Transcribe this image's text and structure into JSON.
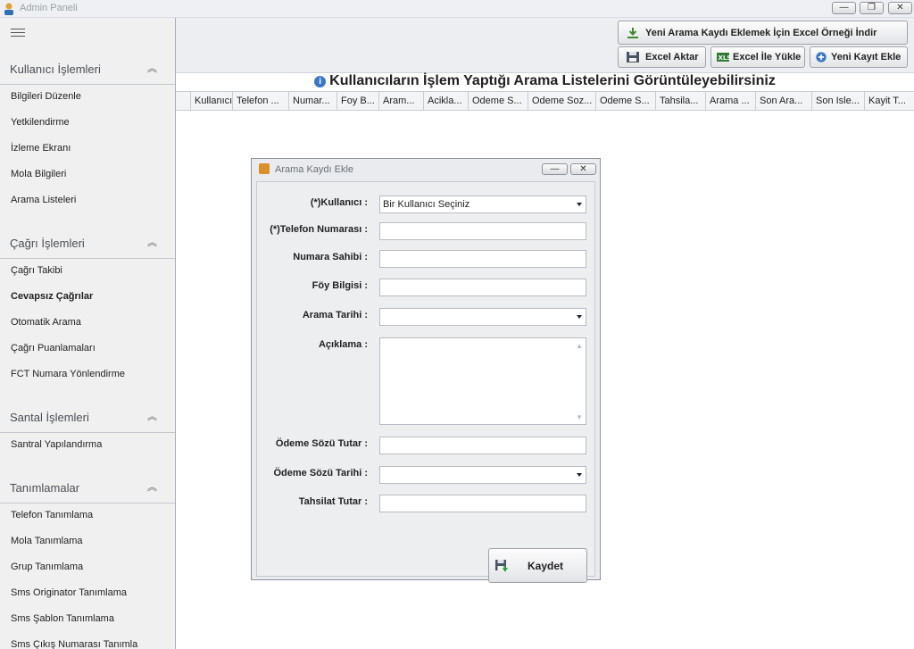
{
  "window": {
    "title": "Admin Paneli",
    "buttons": [
      "—",
      "❐",
      "✕"
    ]
  },
  "sidebar": {
    "groups": [
      {
        "title": "Kullanıcı İşlemleri",
        "items": [
          {
            "label": "Bilgileri Düzenle"
          },
          {
            "label": "Yetkilendirme"
          },
          {
            "label": "İzleme Ekranı"
          },
          {
            "label": "Mola Bilgileri"
          },
          {
            "label": "Arama Listeleri"
          }
        ]
      },
      {
        "title": "Çağrı İşlemleri",
        "items": [
          {
            "label": "Çağrı Takibi"
          },
          {
            "label": "Cevapsız Çağrılar"
          },
          {
            "label": "Otomatik Arama"
          },
          {
            "label": "Çağrı Puanlamaları"
          },
          {
            "label": "FCT Numara Yönlendirme"
          }
        ]
      },
      {
        "title": "Santal İşlemleri",
        "items": [
          {
            "label": "Santral Yapılandırma"
          }
        ]
      },
      {
        "title": "Tanımlamalar",
        "items": [
          {
            "label": "Telefon Tanımlama"
          },
          {
            "label": "Mola Tanımlama"
          },
          {
            "label": "Grup Tanımlama"
          },
          {
            "label": "Sms Originator Tanımlama"
          },
          {
            "label": "Sms Şablon Tanımlama"
          },
          {
            "label": "Sms Çıkış Numarası Tanımla"
          }
        ]
      }
    ],
    "active_item": "Cevapsız Çağrılar"
  },
  "toolbar": {
    "excel_template_label": "Yeni Arama Kaydı Eklemek İçin Excel Örneği İndir",
    "export_label": "Excel Aktar",
    "import_label": "Excel İle Yükle",
    "add_label": "Yeni Kayıt Ekle"
  },
  "page": {
    "heading": "Kullanıcıların İşlem Yaptığı Arama Listelerini Görüntüleyebilirsiniz",
    "info_icon": "info-icon"
  },
  "grid": {
    "columns": [
      "Kullanıcı",
      "Telefon ...",
      "Numar...",
      "Foy B...",
      "Aram...",
      "Acikla...",
      "Odeme S...",
      "Odeme Soz...",
      "Odeme S...",
      "Tahsila...",
      "Arama ...",
      "Son Ara...",
      "Son Isle...",
      "Kayit T..."
    ]
  },
  "dialog": {
    "title": "Arama Kaydı Ekle",
    "fields": {
      "user_label": "(*)Kullanıcı :",
      "user_value": "Bir Kullanıcı Seçiniz",
      "phone_label": "(*)Telefon Numarası :",
      "owner_label": "Numara Sahibi :",
      "file_label": "Föy Bilgisi :",
      "call_date_label": "Arama Tarihi :",
      "desc_label": "Açıklama :",
      "promise_amount_label": "Ödeme Sözü Tutar :",
      "promise_date_label": "Ödeme Sözü Tarihi :",
      "collection_label": "Tahsilat Tutar :"
    },
    "save_label": "Kaydet"
  },
  "colors": {
    "accent": "#3b78c4",
    "sidebar_bg": "#f0f0f0",
    "toolbar_bg": "#eceef1"
  }
}
